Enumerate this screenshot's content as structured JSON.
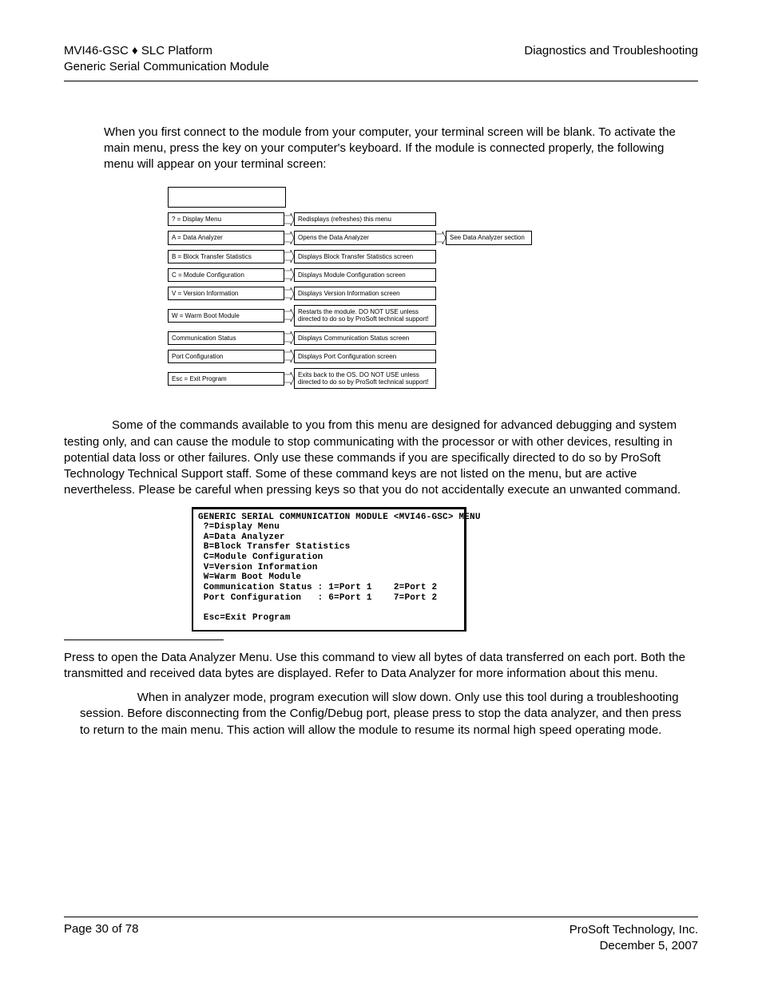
{
  "header": {
    "left1": "MVI46-GSC ♦ SLC Platform",
    "left2": "Generic Serial Communication Module",
    "right": "Diagnostics and Troubleshooting"
  },
  "intro": "When you first connect to the module from your computer, your terminal screen will be blank. To activate the main menu, press the      key on your computer's keyboard. If the module is connected properly, the following menu will appear on your terminal screen:",
  "diagram": {
    "rows": [
      {
        "cmd": "? = Display Menu",
        "desc": "Redisplays (refreshes) this menu",
        "ext": ""
      },
      {
        "cmd": "A = Data Analyzer",
        "desc": "Opens the Data Analyzer",
        "ext": "See Data Analyzer section"
      },
      {
        "cmd": "B = Block Transfer Statistics",
        "desc": "Displays Block Transfer Statistics screen",
        "ext": ""
      },
      {
        "cmd": "C = Module Configuration",
        "desc": "Displays Module Configuration screen",
        "ext": ""
      },
      {
        "cmd": "V = Version Information",
        "desc": "Displays Version Information screen",
        "ext": ""
      },
      {
        "cmd": "W = Warm Boot Module",
        "desc": "Restarts the module. DO NOT USE unless directed to do so by ProSoft technical support!",
        "ext": ""
      },
      {
        "cmd": "Communication Status",
        "desc": "Displays Communication Status screen",
        "ext": ""
      },
      {
        "cmd": "Port Configuration",
        "desc": "Displays Port Configuration screen",
        "ext": ""
      },
      {
        "cmd": "Esc = Exit Program",
        "desc": "Exits back to the OS. DO NOT USE unless directed to do so by ProSoft technical support!",
        "ext": ""
      }
    ]
  },
  "caution": "Some of the commands available to you from this menu are designed for advanced debugging and system testing only, and can cause the module to stop communicating with the processor or with other devices, resulting in potential data loss or other failures. Only use these commands if you are specifically directed to do so by ProSoft Technology Technical Support staff. Some of these command keys are not listed on the menu, but are active nevertheless. Please be careful when pressing keys so that you do not accidentally execute an unwanted command.",
  "terminal": "GENERIC SERIAL COMMUNICATION MODULE <MVI46-GSC> MENU\n ?=Display Menu\n A=Data Analyzer\n B=Block Transfer Statistics\n C=Module Configuration\n V=Version Information\n W=Warm Boot Module\n Communication Status : 1=Port 1    2=Port 2\n Port Configuration   : 6=Port 1    7=Port 2\n\n Esc=Exit Program",
  "section2": {
    "para": "Press      to open the Data Analyzer Menu. Use this command to view all bytes of data transferred on each port. Both the transmitted and received data bytes are displayed. Refer to Data Analyzer for more information about this menu.",
    "important": "When in analyzer mode, program execution will slow down. Only use this tool during a troubleshooting session. Before disconnecting from the Config/Debug port, please press      to stop the data analyzer, and then press      to return to the main menu. This action will allow the module to resume its normal high speed operating mode."
  },
  "footer": {
    "left": "Page 30 of 78",
    "right1": "ProSoft Technology, Inc.",
    "right2": "December 5, 2007"
  }
}
